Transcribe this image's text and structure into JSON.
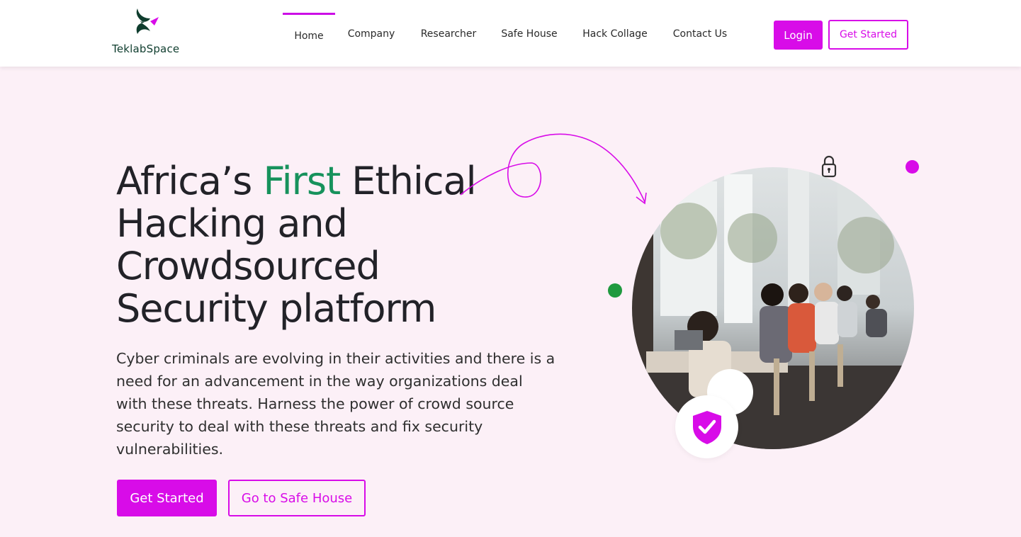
{
  "brand": {
    "name": "TeklabSpace",
    "logo_icon": "teklabspace-logo-icon",
    "accent_color": "#d80ce8",
    "green_color": "#17925c"
  },
  "nav": {
    "items": [
      {
        "label": "Home",
        "active": true
      },
      {
        "label": "Company",
        "active": false
      },
      {
        "label": "Researcher",
        "active": false
      },
      {
        "label": "Safe House",
        "active": false
      },
      {
        "label": "Hack Collage",
        "active": false
      },
      {
        "label": "Contact Us",
        "active": false
      }
    ]
  },
  "header_actions": {
    "login_label": "Login",
    "get_started_label": "Get Started"
  },
  "hero": {
    "title_part1": "Africa’s ",
    "title_highlight": "First",
    "title_part2": " Ethical Hacking and Crowdsourced Security platform",
    "description": "Cyber criminals are evolving in their activities and there is a need for an advancement in the way organizations deal with these threats. Harness the power of crowd source security to deal with these threats and fix security vulnerabilities.",
    "primary_button": "Get Started",
    "secondary_button": "Go to Safe House",
    "image_icon": "people-working-photo",
    "badge_icon": "shield-check-icon"
  }
}
